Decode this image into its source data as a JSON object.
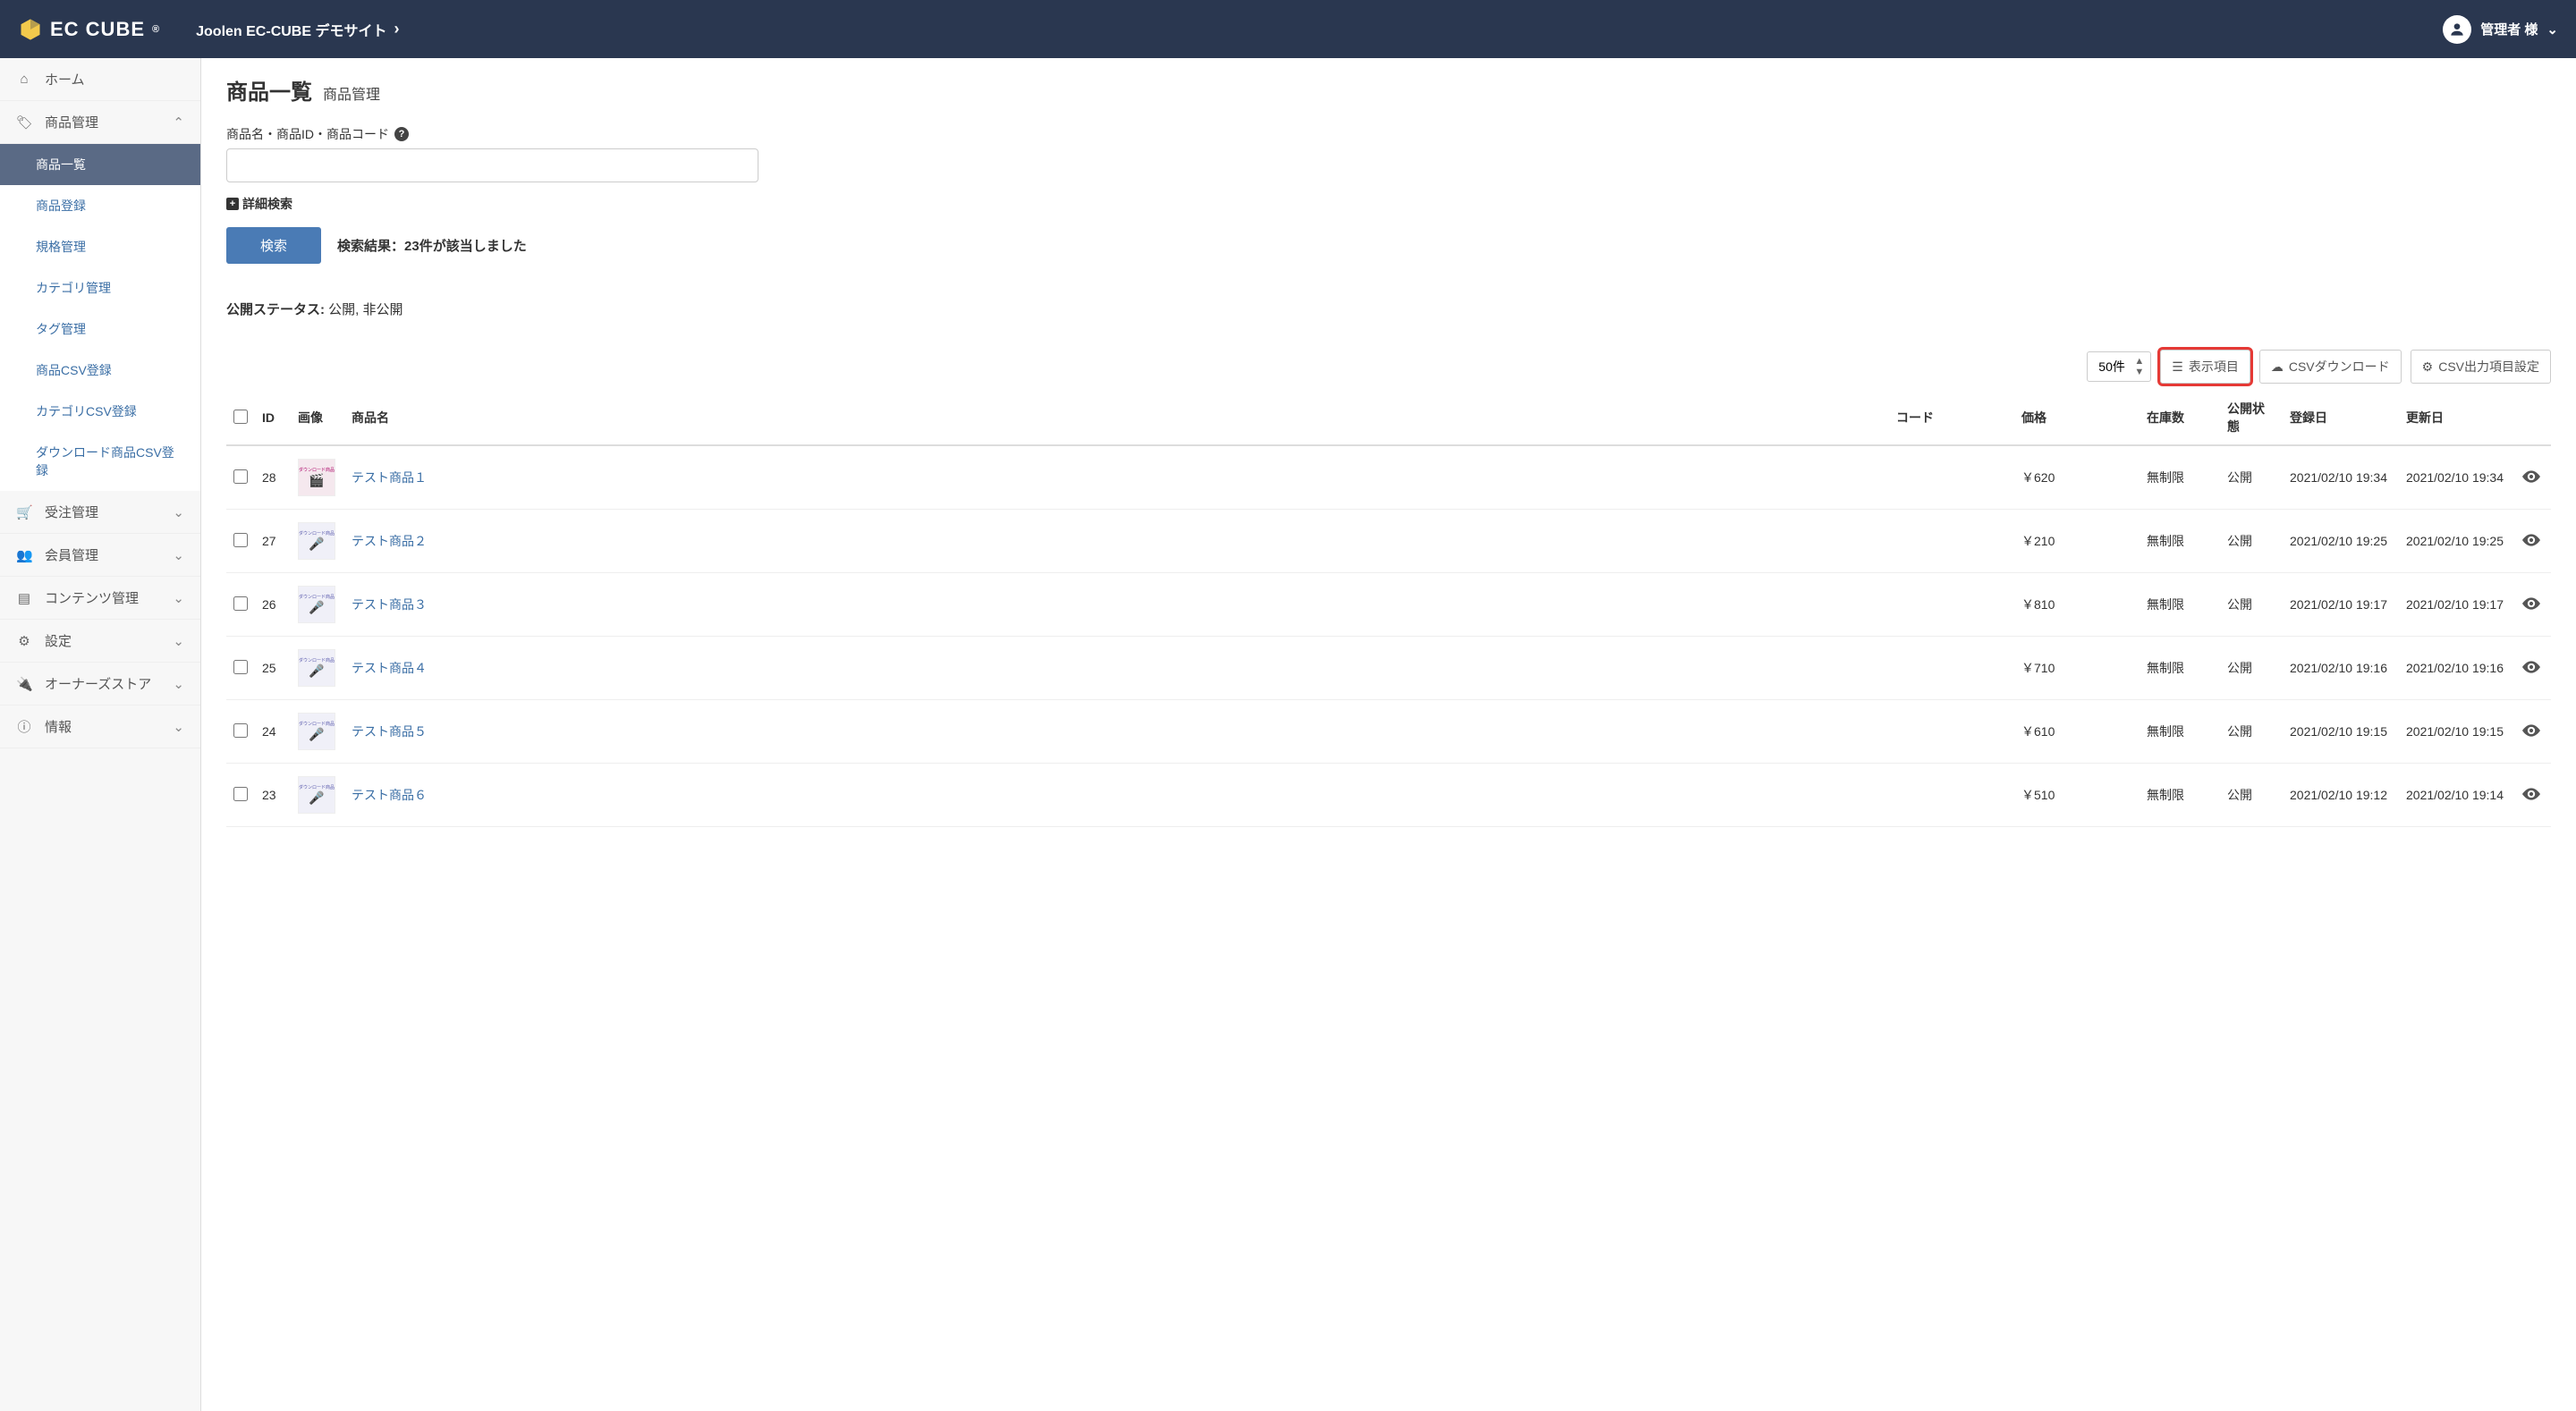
{
  "header": {
    "brand": "EC CUBE",
    "site_name": "Joolen EC-CUBE デモサイト",
    "user_label": "管理者 様"
  },
  "sidebar": {
    "home": "ホーム",
    "product_mgmt": "商品管理",
    "subs": {
      "list": "商品一覧",
      "register": "商品登録",
      "class": "規格管理",
      "category": "カテゴリ管理",
      "tag": "タグ管理",
      "csv_product": "商品CSV登録",
      "csv_category": "カテゴリCSV登録",
      "csv_download": "ダウンロード商品CSV登録"
    },
    "order": "受注管理",
    "customer": "会員管理",
    "content": "コンテンツ管理",
    "setting": "設定",
    "owner": "オーナーズストア",
    "info": "情報"
  },
  "page": {
    "title": "商品一覧",
    "subtitle": "商品管理",
    "search_label": "商品名・商品ID・商品コード",
    "adv_search": "詳細検索",
    "search_button": "検索",
    "result_text": "検索結果：23件が該当しました",
    "status_label": "公開ステータス:",
    "status_value": "公開, 非公開",
    "per_page": "50件",
    "display_cols": "表示項目",
    "csv_download": "CSVダウンロード",
    "csv_settings": "CSV出力項目設定"
  },
  "table": {
    "headers": {
      "id": "ID",
      "image": "画像",
      "name": "商品名",
      "code": "コード",
      "price": "価格",
      "stock": "在庫数",
      "status": "公開状態",
      "created": "登録日",
      "updated": "更新日"
    },
    "rows": [
      {
        "id": "28",
        "thumb_type": "video",
        "name": "テスト商品１",
        "code": "",
        "price": "￥620",
        "stock": "無制限",
        "status": "公開",
        "created": "2021/02/10 19:34",
        "updated": "2021/02/10 19:34"
      },
      {
        "id": "27",
        "thumb_type": "audio",
        "name": "テスト商品２",
        "code": "",
        "price": "￥210",
        "stock": "無制限",
        "status": "公開",
        "created": "2021/02/10 19:25",
        "updated": "2021/02/10 19:25"
      },
      {
        "id": "26",
        "thumb_type": "audio",
        "name": "テスト商品３",
        "code": "",
        "price": "￥810",
        "stock": "無制限",
        "status": "公開",
        "created": "2021/02/10 19:17",
        "updated": "2021/02/10 19:17"
      },
      {
        "id": "25",
        "thumb_type": "audio",
        "name": "テスト商品４",
        "code": "",
        "price": "￥710",
        "stock": "無制限",
        "status": "公開",
        "created": "2021/02/10 19:16",
        "updated": "2021/02/10 19:16"
      },
      {
        "id": "24",
        "thumb_type": "audio",
        "name": "テスト商品５",
        "code": "",
        "price": "￥610",
        "stock": "無制限",
        "status": "公開",
        "created": "2021/02/10 19:15",
        "updated": "2021/02/10 19:15"
      },
      {
        "id": "23",
        "thumb_type": "audio",
        "name": "テスト商品６",
        "code": "",
        "price": "￥510",
        "stock": "無制限",
        "status": "公開",
        "created": "2021/02/10 19:12",
        "updated": "2021/02/10 19:14"
      }
    ]
  }
}
